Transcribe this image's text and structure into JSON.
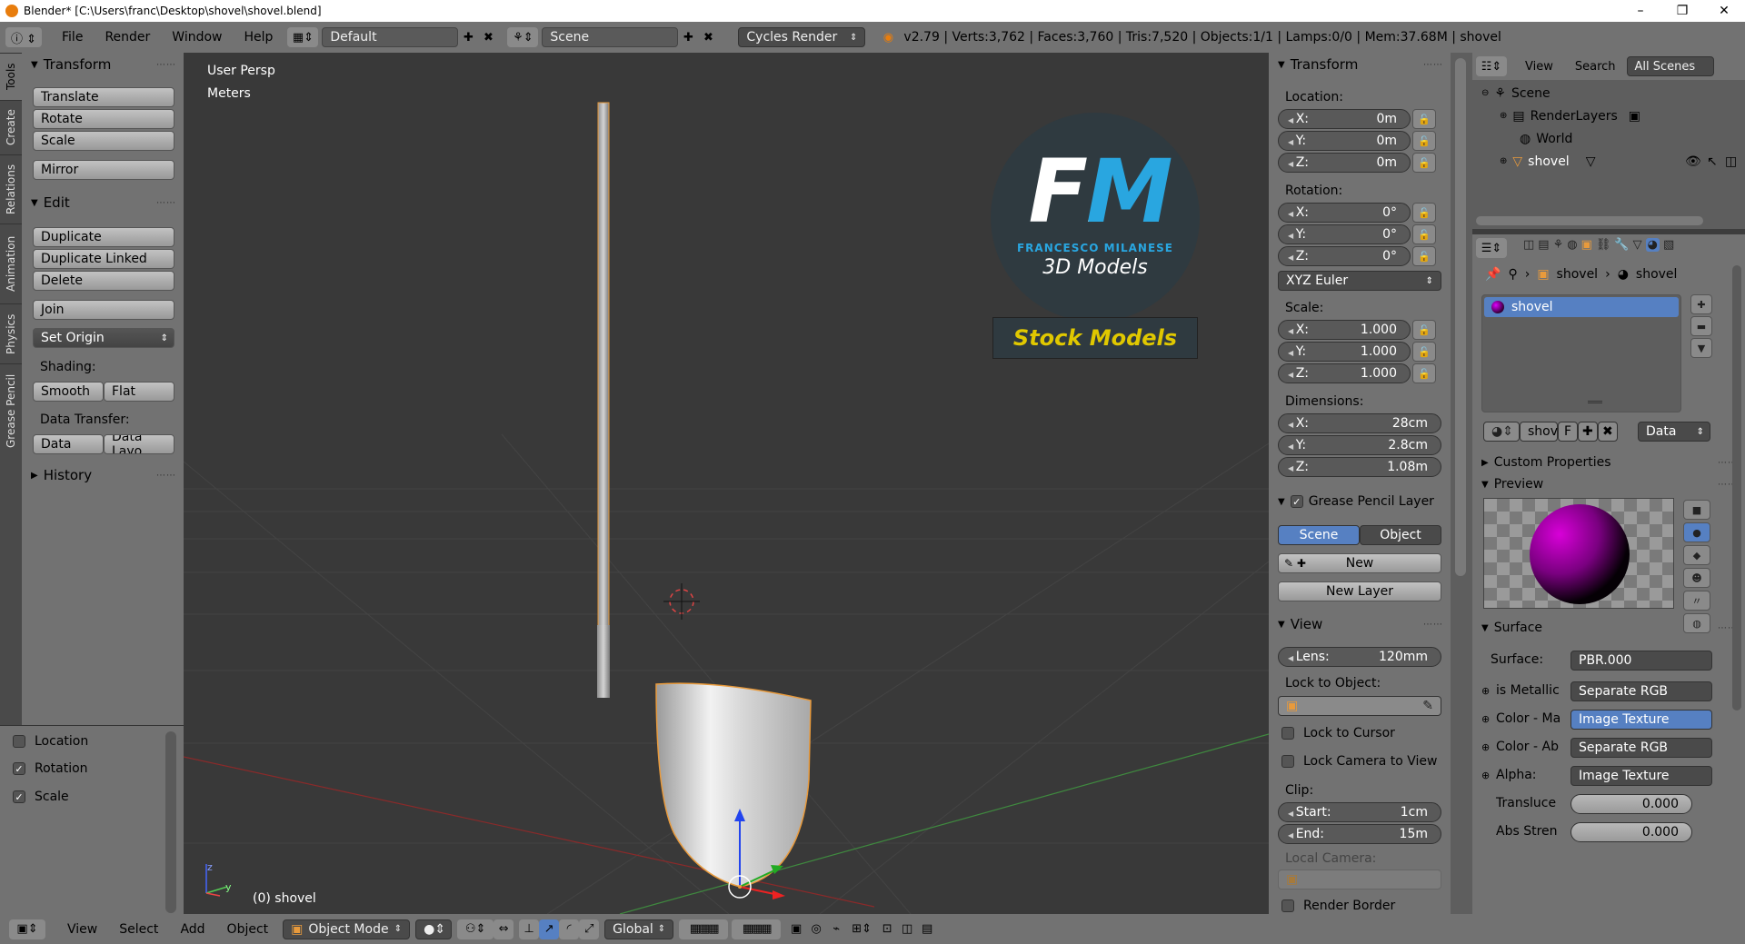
{
  "window": {
    "title": "Blender* [C:\\Users\\franc\\Desktop\\shovel\\shovel.blend]",
    "minimize": "–",
    "maximize": "❐",
    "close": "✕"
  },
  "info_header": {
    "menus": [
      "File",
      "Render",
      "Window",
      "Help"
    ],
    "layout": "Default",
    "scene": "Scene",
    "render_engine": "Cycles Render",
    "stats": "v2.79 | Verts:3,762 | Faces:3,760 | Tris:7,520 | Objects:1/1 | Lamps:0/0 | Mem:37.68M | shovel"
  },
  "left_tabs": [
    "Tools",
    "Create",
    "Relations",
    "Animation",
    "Physics",
    "Grease Pencil"
  ],
  "tool_shelf": {
    "transform_title": "Transform",
    "translate": "Translate",
    "rotate": "Rotate",
    "scale": "Scale",
    "mirror": "Mirror",
    "edit_title": "Edit",
    "duplicate": "Duplicate",
    "duplicate_linked": "Duplicate Linked",
    "delete": "Delete",
    "join": "Join",
    "set_origin": "Set Origin",
    "shading_label": "Shading:",
    "smooth": "Smooth",
    "flat": "Flat",
    "data_transfer_label": "Data Transfer:",
    "data": "Data",
    "data_layout": "Data Layo",
    "history_title": "History"
  },
  "operator_panel": {
    "location": "Location",
    "rotation": "Rotation",
    "scale": "Scale",
    "location_checked": false,
    "rotation_checked": true,
    "scale_checked": true
  },
  "viewport": {
    "view_name": "User Persp",
    "units": "Meters",
    "object_label": "(0) shovel",
    "logo_initials": "FM",
    "logo_name": "FRANCESCO MILANESE",
    "logo_sub": "3D Models",
    "logo_banner": "Stock Models"
  },
  "n_panel": {
    "transform_title": "Transform",
    "location_label": "Location:",
    "location": [
      {
        "axis": "X:",
        "value": "0m"
      },
      {
        "axis": "Y:",
        "value": "0m"
      },
      {
        "axis": "Z:",
        "value": "0m"
      }
    ],
    "rotation_label": "Rotation:",
    "rotation": [
      {
        "axis": "X:",
        "value": "0°"
      },
      {
        "axis": "Y:",
        "value": "0°"
      },
      {
        "axis": "Z:",
        "value": "0°"
      }
    ],
    "rotation_mode": "XYZ Euler",
    "scale_label": "Scale:",
    "scale": [
      {
        "axis": "X:",
        "value": "1.000"
      },
      {
        "axis": "Y:",
        "value": "1.000"
      },
      {
        "axis": "Z:",
        "value": "1.000"
      }
    ],
    "dimensions_label": "Dimensions:",
    "dimensions": [
      {
        "axis": "X:",
        "value": "28cm"
      },
      {
        "axis": "Y:",
        "value": "2.8cm"
      },
      {
        "axis": "Z:",
        "value": "1.08m"
      }
    ],
    "grease_title": "Grease Pencil Layer",
    "grease_scene": "Scene",
    "grease_object": "Object",
    "grease_new": "New",
    "grease_new_layer": "New Layer",
    "view_title": "View",
    "lens_label": "Lens:",
    "lens_value": "120mm",
    "lock_to_object": "Lock to Object:",
    "lock_to_cursor": "Lock to Cursor",
    "lock_camera": "Lock Camera to View",
    "clip_label": "Clip:",
    "clip_start_label": "Start:",
    "clip_start": "1cm",
    "clip_end_label": "End:",
    "clip_end": "15m",
    "local_camera": "Local Camera:",
    "render_border": "Render Border"
  },
  "outliner": {
    "view": "View",
    "search": "Search",
    "filter": "All Scenes",
    "items": [
      "Scene",
      "RenderLayers",
      "World",
      "shovel"
    ]
  },
  "properties": {
    "breadcrumb_object": "shovel",
    "breadcrumb_material": "shovel",
    "slot_name": "shovel",
    "material_name": "shov",
    "fake_user": "F",
    "link": "Data",
    "custom_properties": "Custom Properties",
    "preview": "Preview",
    "surface_title": "Surface",
    "surface_label": "Surface:",
    "surface_value": "PBR.000",
    "inputs": [
      {
        "label": "is Metallic",
        "value": "Separate RGB"
      },
      {
        "label": "Color - Ma",
        "value": "Image Texture"
      },
      {
        "label": "Color - Ab",
        "value": "Separate RGB"
      },
      {
        "label": "Alpha:",
        "value": "Image Texture"
      },
      {
        "label": "Transluce",
        "value": "0.000"
      },
      {
        "label": "Abs Stren",
        "value": "0.000"
      }
    ]
  },
  "bottom_bar": {
    "menus": [
      "View",
      "Select",
      "Add",
      "Object"
    ],
    "mode": "Object Mode",
    "orientation": "Global"
  },
  "colors": {
    "panel": "#727272",
    "viewport": "#393939",
    "selection": "#5680c2",
    "logo_blue": "#29a6e0",
    "logo_yellow": "#e0c800"
  }
}
